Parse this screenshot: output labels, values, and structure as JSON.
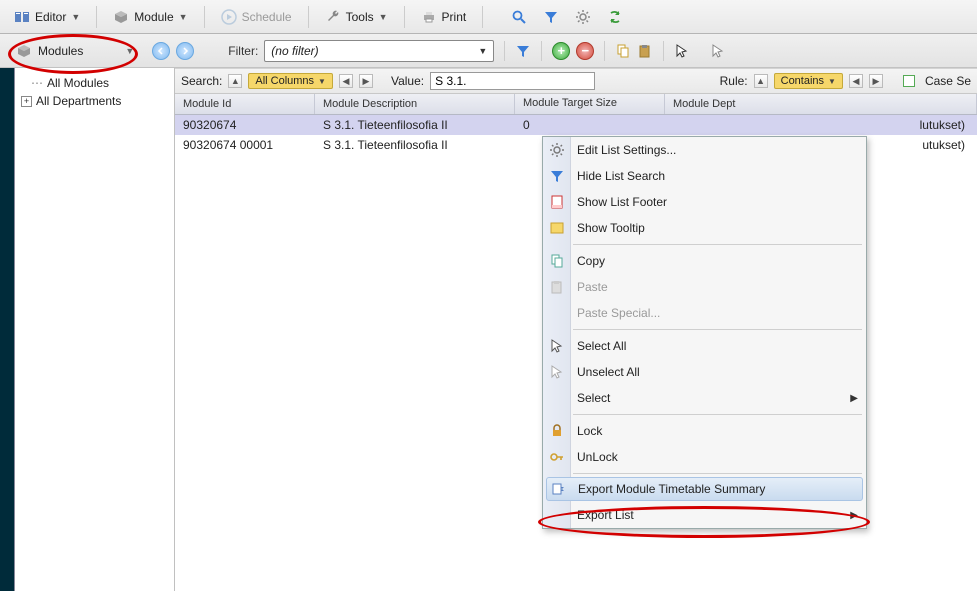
{
  "toolbar1": {
    "editor": "Editor",
    "module": "Module",
    "schedule": "Schedule",
    "tools": "Tools",
    "print": "Print"
  },
  "toolbar2": {
    "modules": "Modules",
    "filter_label": "Filter:",
    "filter_value": "(no filter)"
  },
  "sidebar": {
    "all_modules": "All Modules",
    "all_departments": "All Departments"
  },
  "searchbar": {
    "search_label": "Search:",
    "columns_label": "All Columns",
    "value_label": "Value:",
    "value": "S 3.1.",
    "rule_label": "Rule:",
    "rule_value": "Contains",
    "case_label": "Case Se"
  },
  "table": {
    "headers": {
      "id": "Module Id",
      "desc": "Module Description",
      "size": "Module Target Size",
      "dept": "Module Dept"
    },
    "rows": [
      {
        "id": "90320674",
        "desc": "S 3.1. Tieteenfilosofia II",
        "size": "0",
        "dept_tail": "lutukset)"
      },
      {
        "id": "90320674 00001",
        "desc": "S 3.1. Tieteenfilosofia II",
        "size": "",
        "dept_tail": "utukset)"
      }
    ]
  },
  "contextmenu": {
    "edit_settings": "Edit List Settings...",
    "hide_search": "Hide List Search",
    "show_footer": "Show List Footer",
    "show_tooltip": "Show Tooltip",
    "copy": "Copy",
    "paste": "Paste",
    "paste_special": "Paste Special...",
    "select_all": "Select All",
    "unselect_all": "Unselect All",
    "select": "Select",
    "lock": "Lock",
    "unlock": "UnLock",
    "export_summary": "Export Module Timetable Summary",
    "export_list": "Export List"
  }
}
